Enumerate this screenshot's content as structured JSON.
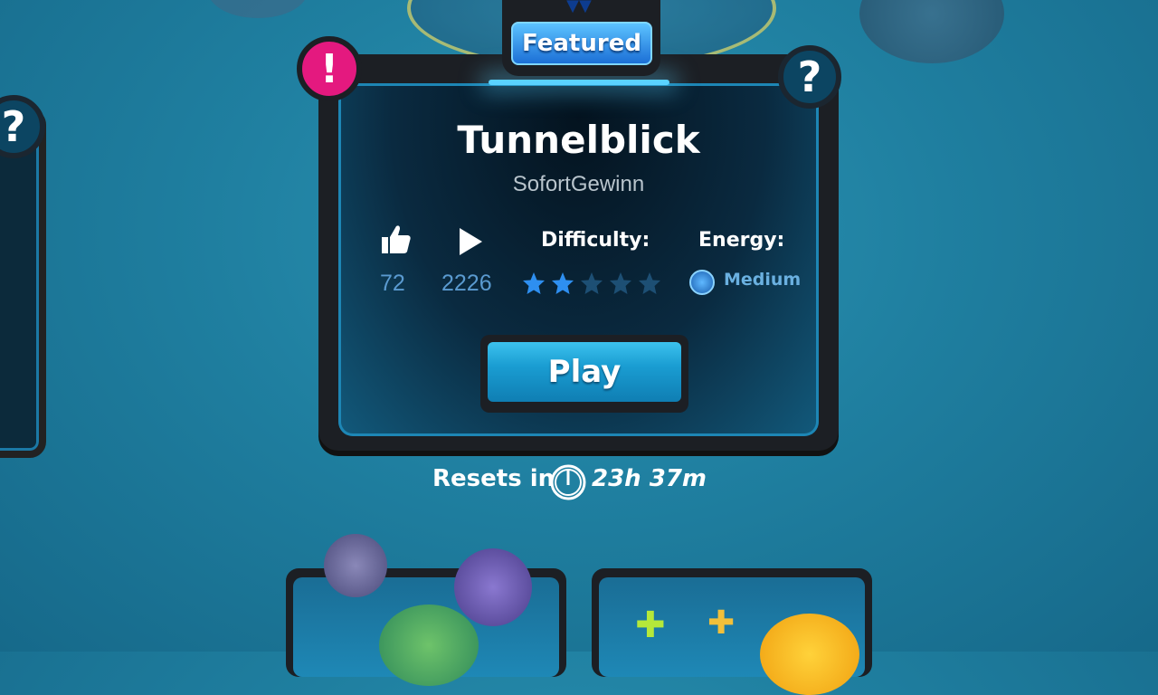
{
  "featured": {
    "label": "Featured"
  },
  "badges": {
    "alert": "!",
    "help": "?"
  },
  "level": {
    "title": "Tunnelblick",
    "author": "SofortGewinn",
    "likes": "72",
    "plays": "2226",
    "difficulty_label": "Difficulty:",
    "difficulty_rating": 2,
    "difficulty_max": 5,
    "energy_label": "Energy:",
    "energy_value": "Medium"
  },
  "play_button": {
    "label": "Play"
  },
  "reset": {
    "label": "Resets in",
    "time": "23h 37m"
  },
  "colors": {
    "accent": "#1a9dd2",
    "alert": "#e4197f",
    "star_on": "#2e8ff0",
    "star_off": "#1d4f74",
    "stat_value": "#5a9ad0"
  },
  "icons": [
    "alert-icon",
    "help-icon",
    "thumbs-up-icon",
    "play-icon",
    "star-icon",
    "energy-icon",
    "timer-icon"
  ]
}
